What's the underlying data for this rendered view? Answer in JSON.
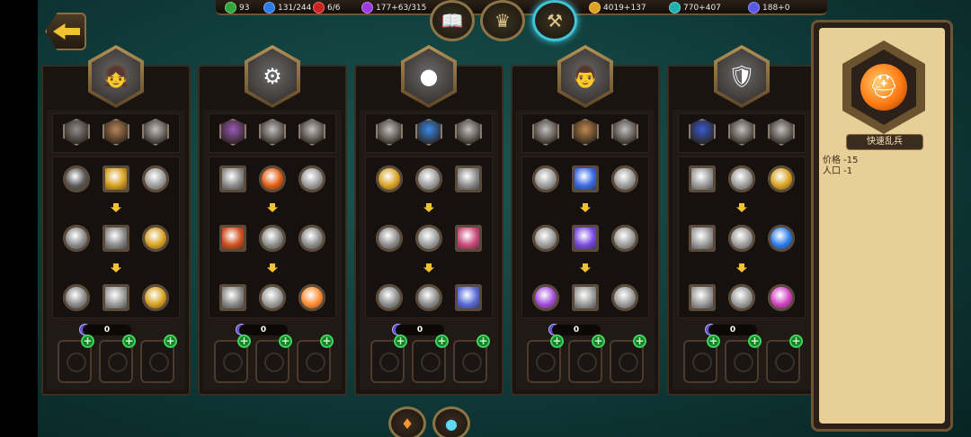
{
  "resources": {
    "xp": "93",
    "population": "131/244",
    "red": "6/6",
    "purple": "177+63/315",
    "gold": "4019+137",
    "gems": "770+407",
    "mana": "188+0"
  },
  "icons": {
    "xp": "green-leaf-icon",
    "population": "blue-person-icon",
    "red": "red-orb-icon",
    "purple": "purple-orb-icon",
    "gold": "gold-coin-icon",
    "gems": "teal-gem-icon",
    "mana": "blue-crystal-icon"
  },
  "colors": {
    "accent_gold": "#f2c230",
    "background": "#0f3a38",
    "plus_green": "#3fd75a",
    "highlight_teal": "#3fd7ee"
  },
  "heroes": [
    {
      "name": "hero-1",
      "counter": "0",
      "portrait_icon": "girl-hero",
      "top": [
        "#8e8e8e",
        "#b8845a",
        "#c0c0c0"
      ],
      "skills": [
        "#5a5a5a",
        "#d6a020",
        "#9a9a9a",
        "#8a8a8a",
        "#8a8a8a",
        "#d6a020",
        "#8a8a8a",
        "#9a9a9a",
        "#d6a020"
      ]
    },
    {
      "name": "hero-2",
      "counter": "0",
      "portrait_icon": "catapult-hero",
      "top": [
        "#9a5ab8",
        "#c0c0c0",
        "#c0c0c0"
      ],
      "skills": [
        "#8a8a8a",
        "#e05a10",
        "#9a9a9a",
        "#d05020",
        "#8a8a8a",
        "#8a8a8a",
        "#8a8a8a",
        "#9a9a9a",
        "#ff8a30"
      ]
    },
    {
      "name": "hero-3",
      "counter": "0",
      "portrait_icon": "cannon-hero",
      "top": [
        "#c0c0c0",
        "#3a8ae8",
        "#c0c0c0"
      ],
      "skills": [
        "#d6a020",
        "#9a9a9a",
        "#8a8a8a",
        "#8a8a8a",
        "#9a9a9a",
        "#c84a7a",
        "#8a8a8a",
        "#8a8a8a",
        "#5a6ad8"
      ]
    },
    {
      "name": "hero-4",
      "counter": "0",
      "portrait_icon": "soldier-hero",
      "top": [
        "#c0c0c0",
        "#c08850",
        "#c0c0c0"
      ],
      "skills": [
        "#9a9a9a",
        "#3a6ae0",
        "#9a9a9a",
        "#9a9a9a",
        "#7a4ae0",
        "#9a9a9a",
        "#a04ad8",
        "#9a9a9a",
        "#9a9a9a"
      ]
    },
    {
      "name": "hero-5",
      "counter": "0",
      "portrait_icon": "knight-hero",
      "top": [
        "#3a5ad0",
        "#c0c0c0",
        "#c0c0c0"
      ],
      "skills": [
        "#9a9a9a",
        "#9a9a9a",
        "#d6a020",
        "#9a9a9a",
        "#9a9a9a",
        "#2a7ae8",
        "#9a9a9a",
        "#9a9a9a",
        "#d040c0"
      ]
    }
  ],
  "panel": {
    "unit_name": "快速乱兵",
    "stat_price": "价格 -15",
    "stat_population": "人口 -1"
  }
}
